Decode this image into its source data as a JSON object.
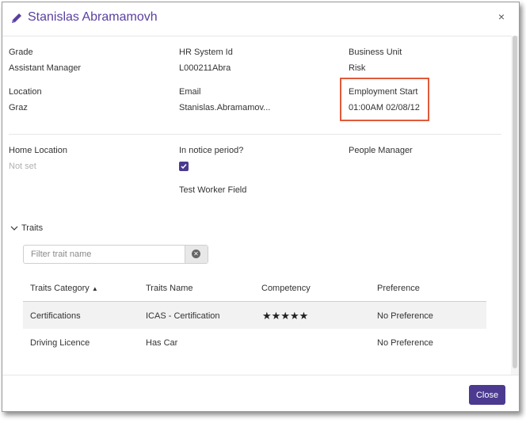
{
  "dialog": {
    "title": "Stanislas Abramamovh",
    "close_glyph": "×"
  },
  "fields": {
    "grade": {
      "label": "Grade",
      "value": "Assistant Manager"
    },
    "hr_system_id": {
      "label": "HR System Id",
      "value": "L000211Abra"
    },
    "business_unit": {
      "label": "Business Unit",
      "value": "Risk"
    },
    "location": {
      "label": "Location",
      "value": "Graz"
    },
    "email": {
      "label": "Email",
      "value": "Stanislas.Abramamov..."
    },
    "employment_start": {
      "label": "Employment Start",
      "value": "01:00AM 02/08/12"
    },
    "home_location": {
      "label": "Home Location",
      "value": "Not set"
    },
    "in_notice_period": {
      "label": "In notice period?",
      "checked": true
    },
    "people_manager": {
      "label": "People Manager"
    },
    "test_worker_field": {
      "label": "Test Worker Field"
    }
  },
  "traits": {
    "section_label": "Traits",
    "filter_placeholder": "Filter trait name",
    "columns": [
      "Traits Category",
      "Traits Name",
      "Competency",
      "Preference"
    ],
    "sort_glyph": "▲",
    "rows": [
      {
        "category": "Certifications",
        "name": "ICAS - Certification",
        "competency_stars": 5,
        "preference": "No Preference"
      },
      {
        "category": "Driving Licence",
        "name": "Has Car",
        "competency_stars": 0,
        "preference": "No Preference"
      }
    ]
  },
  "footer": {
    "close_label": "Close"
  },
  "colors": {
    "accent": "#4b3a8f",
    "title": "#5a3fa0",
    "highlight": "#e05a3a"
  }
}
